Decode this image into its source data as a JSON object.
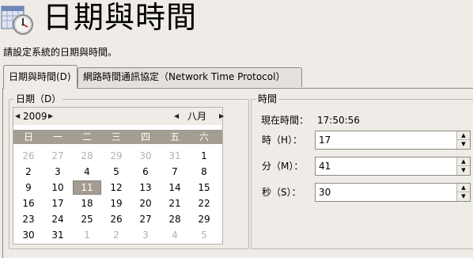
{
  "header": {
    "icon": "calendar-clock-icon",
    "title": "日期與時間",
    "subtitle": "請設定系統的日期與時間。"
  },
  "tabs": [
    {
      "label": "日期與時間(D)"
    },
    {
      "label": "網路時間通訊協定（Network Time Protocol）"
    }
  ],
  "date_group": {
    "label": "日期（D）"
  },
  "calendar": {
    "year": "2009",
    "month": "八月",
    "weekdays": [
      "日",
      "一",
      "二",
      "三",
      "四",
      "五",
      "六"
    ],
    "weeks": [
      [
        "26",
        "27",
        "28",
        "29",
        "30",
        "31",
        "1"
      ],
      [
        "2",
        "3",
        "4",
        "5",
        "6",
        "7",
        "8"
      ],
      [
        "9",
        "10",
        "11",
        "12",
        "13",
        "14",
        "15"
      ],
      [
        "16",
        "17",
        "18",
        "19",
        "20",
        "21",
        "22"
      ],
      [
        "23",
        "24",
        "25",
        "26",
        "27",
        "28",
        "29"
      ],
      [
        "30",
        "31",
        "1",
        "2",
        "3",
        "4",
        "5"
      ]
    ],
    "selected_day": "11"
  },
  "time_group": {
    "label": "時間",
    "current_time_label": "現在時間：",
    "current_time_value": "17:50:56",
    "hour_label": "時（H）：",
    "hour_value": "17",
    "minute_label": "分（M）：",
    "minute_value": "41",
    "second_label": "秒（S）：",
    "second_value": "30"
  },
  "colors": {
    "background": "#efebe7",
    "weekday_header": "#a49d91",
    "other_month_text": "#b4b1ad"
  }
}
